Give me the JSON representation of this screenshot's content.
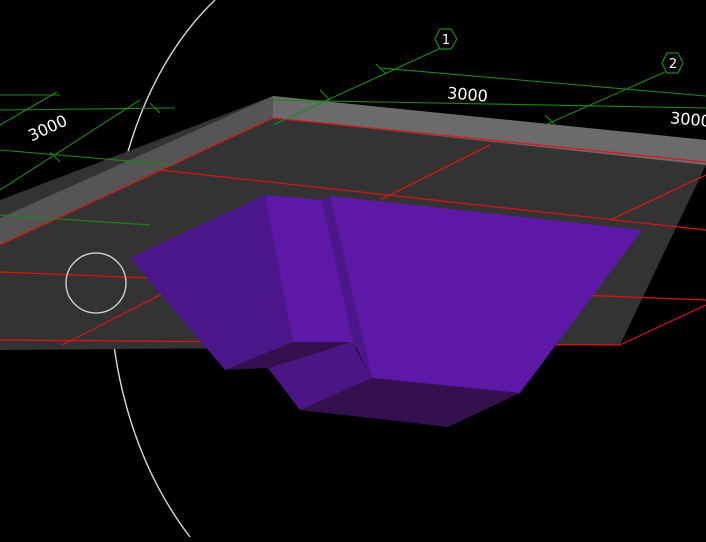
{
  "viewport": {
    "background_color": "#000000",
    "slab": {
      "top_color": "#333333",
      "edge_color": "#6b6b6b",
      "grid_color": "#e01414"
    },
    "object": {
      "face_main_color": "#5e18a8",
      "face_shade_color": "#4a168a",
      "face_dark_color": "#35104f",
      "face_mid_color": "#4c1585"
    },
    "grid_axes": {
      "color": "#1a8a1a",
      "tags": [
        "1",
        "2"
      ]
    },
    "dimensions": {
      "color": "#ffffff",
      "labels": [
        "3000",
        "3000",
        "3000"
      ]
    },
    "view_cube": {
      "ring_color": "#d9d9d9"
    }
  }
}
